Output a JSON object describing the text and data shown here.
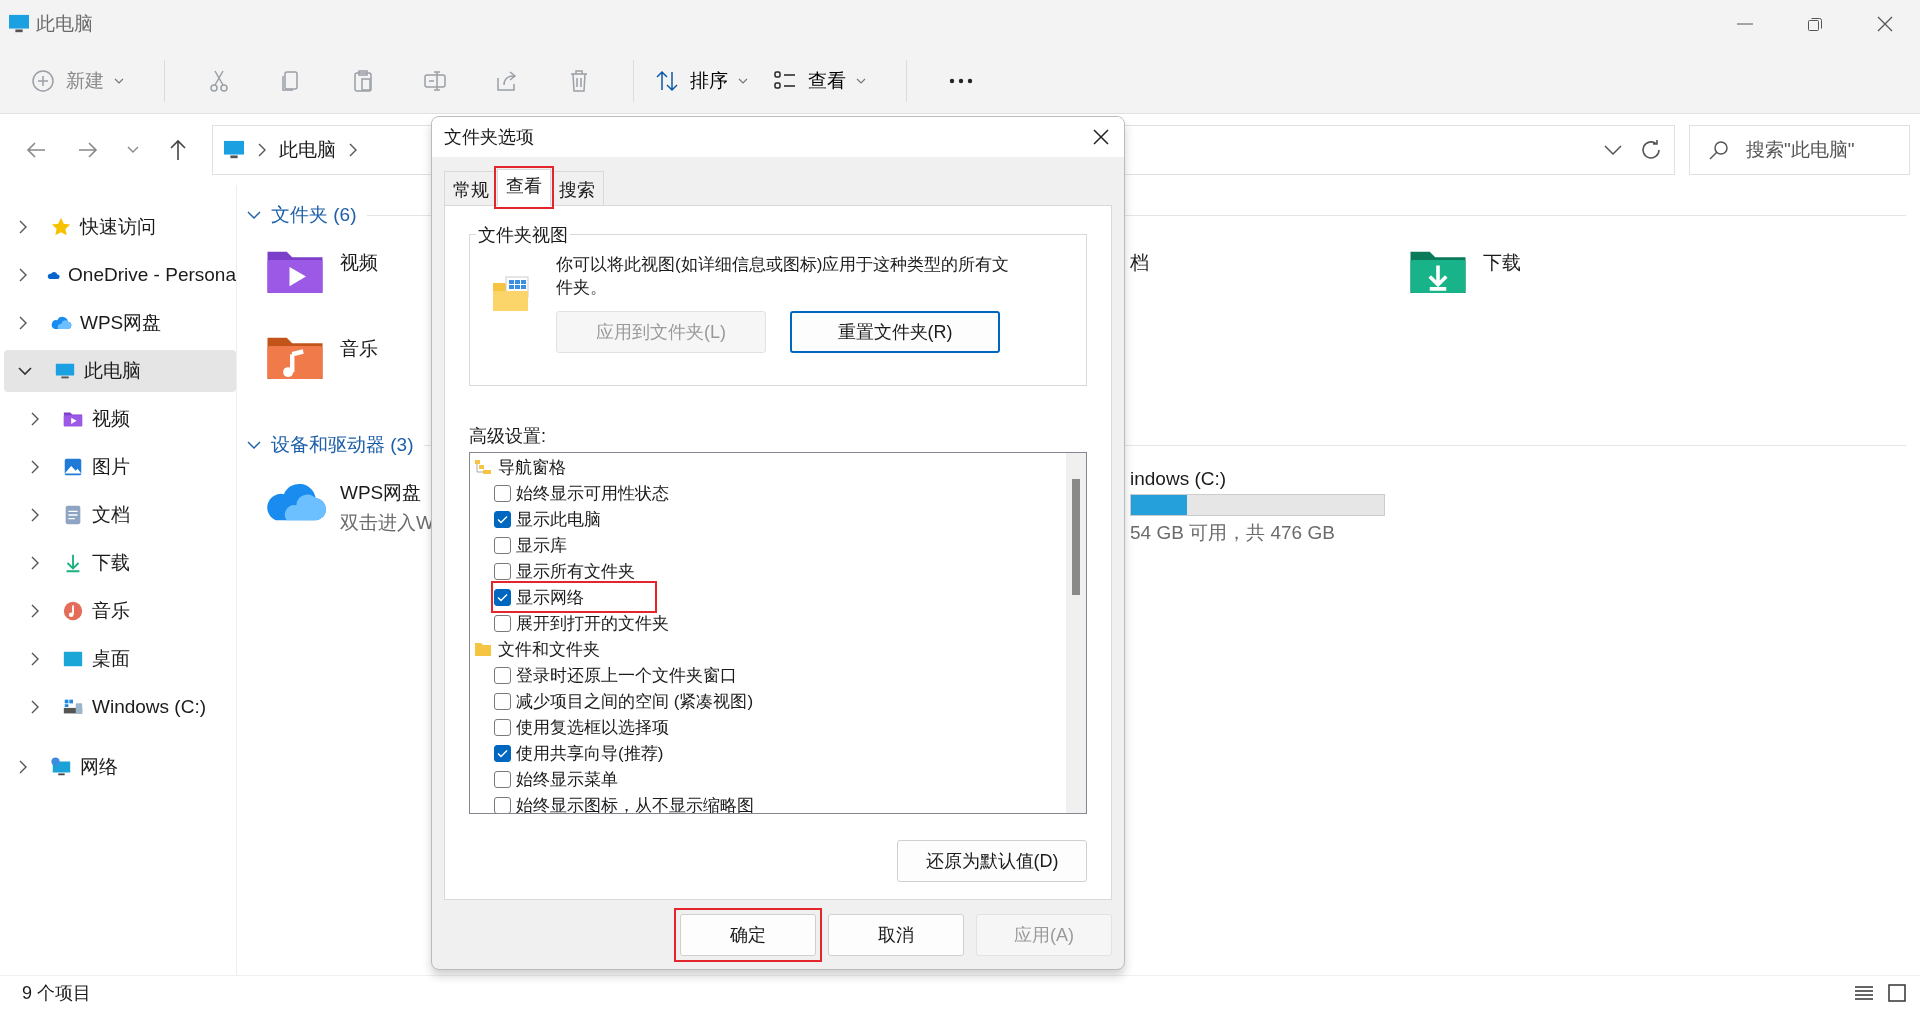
{
  "window": {
    "title": "此电脑"
  },
  "toolbar": {
    "items": [
      {
        "kind": "new",
        "label": "新建",
        "disabled": true
      },
      {
        "kind": "cut",
        "disabled": true
      },
      {
        "kind": "copy",
        "disabled": true
      },
      {
        "kind": "paste",
        "disabled": true
      },
      {
        "kind": "rename",
        "disabled": true
      },
      {
        "kind": "share",
        "disabled": true
      },
      {
        "kind": "delete",
        "disabled": true
      },
      {
        "kind": "sort",
        "label": "排序",
        "disabled": false
      },
      {
        "kind": "view",
        "label": "查看",
        "disabled": false
      },
      {
        "kind": "more",
        "disabled": false
      }
    ]
  },
  "address_bar": {
    "path": [
      "此电脑"
    ]
  },
  "search": {
    "placeholder": "搜索\"此电脑\""
  },
  "navigation_pane": {
    "items": [
      {
        "kind": "quick_access",
        "label": "快速访问",
        "expanded": false,
        "selected": false
      },
      {
        "kind": "onedrive",
        "label": "OneDrive - Persona",
        "expanded": false,
        "selected": false
      },
      {
        "kind": "wps",
        "label": "WPS网盘",
        "expanded": false,
        "selected": false
      },
      {
        "kind": "pc",
        "label": "此电脑",
        "expanded": true,
        "selected": true,
        "children": [
          {
            "kind": "videos",
            "label": "视频",
            "expanded": false,
            "selected": false
          },
          {
            "kind": "pictures",
            "label": "图片",
            "expanded": false,
            "selected": false
          },
          {
            "kind": "documents",
            "label": "文档",
            "expanded": false,
            "selected": false
          },
          {
            "kind": "downloads",
            "label": "下载",
            "expanded": false,
            "selected": false
          },
          {
            "kind": "music",
            "label": "音乐",
            "expanded": false,
            "selected": false
          },
          {
            "kind": "desktop",
            "label": "桌面",
            "expanded": false,
            "selected": false
          },
          {
            "kind": "drive",
            "label": "Windows (C:)",
            "expanded": false,
            "selected": false
          }
        ]
      },
      {
        "kind": "network",
        "label": "网络",
        "expanded": false,
        "selected": false
      }
    ]
  },
  "content": {
    "sections": [
      {
        "title": "文件夹 (6)",
        "expanded": true,
        "items": [
          {
            "kind": "videos",
            "label": "视频"
          },
          {
            "kind": "partial",
            "label": "档"
          },
          {
            "kind": "downloads",
            "label": "下载"
          },
          {
            "kind": "music",
            "label": "音乐"
          }
        ]
      },
      {
        "title": "设备和驱动器 (3)",
        "expanded": true,
        "items": [
          {
            "kind": "wps",
            "label": "WPS网盘",
            "subtitle": "双击进入W"
          },
          {
            "kind": "drive_partial",
            "label": "indows (C:)",
            "level": 0.22,
            "subtitle": "54 GB 可用，共 476 GB"
          }
        ]
      }
    ]
  },
  "dialog": {
    "title": "文件夹选项",
    "tabs": [
      {
        "label": "常规",
        "selected": false,
        "highlighted": false
      },
      {
        "label": "查看",
        "selected": true,
        "highlighted": true
      },
      {
        "label": "搜索",
        "selected": false,
        "highlighted": false
      }
    ],
    "folder_views": {
      "title": "文件夹视图",
      "description": "你可以将此视图(如详细信息或图标)应用于这种类型的所有文件夹。",
      "buttons": [
        {
          "label": "应用到文件夹(L)",
          "disabled": true
        },
        {
          "label": "重置文件夹(R)",
          "disabled": false
        }
      ]
    },
    "advanced": {
      "label": "高级设置:",
      "items": [
        {
          "kind": "nav_group",
          "label": "导航窗格",
          "children": [
            {
              "label": "始终显示可用性状态",
              "checked": false,
              "highlighted": false
            },
            {
              "label": "显示此电脑",
              "checked": true,
              "highlighted": false
            },
            {
              "label": "显示库",
              "checked": false,
              "highlighted": false
            },
            {
              "label": "显示所有文件夹",
              "checked": false,
              "highlighted": false
            },
            {
              "label": "显示网络",
              "checked": true,
              "highlighted": true
            },
            {
              "label": "展开到打开的文件夹",
              "checked": false,
              "highlighted": false
            }
          ]
        },
        {
          "kind": "folder_group",
          "label": "文件和文件夹",
          "children": [
            {
              "label": "登录时还原上一个文件夹窗口",
              "checked": false,
              "highlighted": false
            },
            {
              "label": "减少项目之间的空间 (紧凑视图)",
              "checked": false,
              "highlighted": false
            },
            {
              "label": "使用复选框以选择项",
              "checked": false,
              "highlighted": false
            },
            {
              "label": "使用共享向导(推荐)",
              "checked": true,
              "highlighted": false
            },
            {
              "label": "始终显示菜单",
              "checked": false,
              "highlighted": false
            },
            {
              "label": "始终显示图标，从不显示缩略图",
              "checked": false,
              "highlighted": false
            }
          ]
        }
      ]
    },
    "restore_button": "还原为默认值(D)",
    "buttons": [
      {
        "label": "确定",
        "disabled": false,
        "highlighted": true
      },
      {
        "label": "取消",
        "disabled": false,
        "highlighted": false
      },
      {
        "label": "应用(A)",
        "disabled": true,
        "highlighted": false
      }
    ]
  },
  "status_bar": {
    "item_count": "9 个项目"
  }
}
